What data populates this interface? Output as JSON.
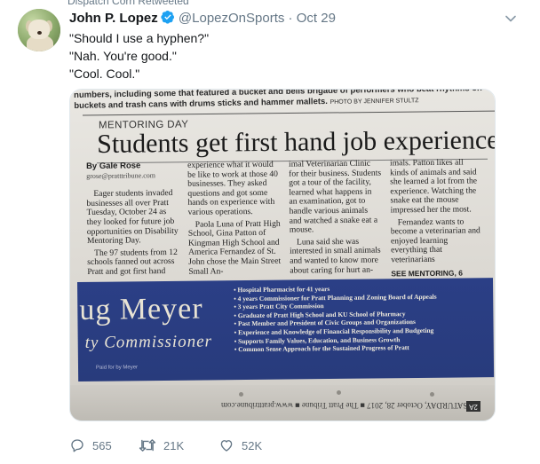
{
  "context": {
    "text": "Dispatch Corn Retweeted"
  },
  "tweet": {
    "author": {
      "name": "John P. Lopez",
      "handle": "@LopezOnSports",
      "separator": "·",
      "date": "Oct 29",
      "verified": true
    },
    "lines": [
      "\"Should I use a hyphen?\"",
      "\"Nah. You're good.\"",
      "\"Cool. Cool.\""
    ],
    "stats": {
      "replies": "565",
      "retweets": "21K",
      "likes": "52K"
    }
  },
  "photo": {
    "caption_line1": "numbers, including some that featured a bucket and bells brigade of performers who beat rhythms on",
    "caption_line2": "buckets and trash cans with drums sticks and hammer mallets.",
    "photo_credit": "PHOTO BY JENNIFER STULTZ",
    "kicker": "MENTORING DAY",
    "headline": "Students get first hand job experience",
    "byline": "By Gale Rose",
    "email": "grose@pratttribune.com",
    "col1": [
      "Eager students invaded businesses all over Pratt Tuesday, October 24 as they looked for future job opportunities on Disability Mentoring Day.",
      "The 97 students from 12 schools fanned out across Pratt and got first hand"
    ],
    "col2": [
      "experience what it would be like to work at those 40 businesses. They asked questions and got some hands on experience with various operations.",
      "Paola Luna of Pratt High School, Gina Patton of Kingman High School and America Fernandez of St. John chose the Main Street Small An-"
    ],
    "col3": [
      "imal Veterinarian Clinic for their business. Students got a tour of the facility, learned what happens in an examination, got to handle various animals and watched a snake eat a mouse.",
      "Luna said she was interested in small animals and wanted to know more about caring for hurt an-"
    ],
    "col4": [
      "imals. Patton likes all kinds of animals and said she learned a lot from the experience. Watching the snake eat the mouse impressed her the most.",
      "Fernandez wants to become a veterinarian and enjoyed learning everything that veterinarians"
    ],
    "see_more": "SEE MENTORING, 6",
    "ad": {
      "name": "ug Meyer",
      "title": "ty Commissioner",
      "fine_print": "Paid for by Meyer",
      "items": [
        "• Hospital Pharmacist for 41 years",
        "• 4 years Commissioner for Pratt Planning and Zoning Board of Appeals",
        "• 3 years Pratt City Commission",
        "• Graduate of Pratt High School and KU School of Pharmacy",
        "• Past Member and President of Civic Groups and Organizations",
        "• Experience and Knowledge of Financial Responsibility and Budgeting",
        "• Supports Family Values, Education, and Business Growth",
        "• Common Sense Approach for the Sustained Progress of Pratt"
      ]
    },
    "footer_line": "SATURDAY, October 28, 2017 ■ The Pratt Tribune ■ www.pratttribune.com",
    "page_number": "2A"
  },
  "icons": {
    "reply": "reply-icon",
    "retweet": "retweet-icon",
    "like": "heart-icon",
    "caret": "chevron-down-icon",
    "verified": "verified-badge-icon"
  },
  "colors": {
    "accent": "#1da1f2",
    "muted": "#657786",
    "text": "#14171a",
    "ad_blue": "#2b3f86"
  }
}
